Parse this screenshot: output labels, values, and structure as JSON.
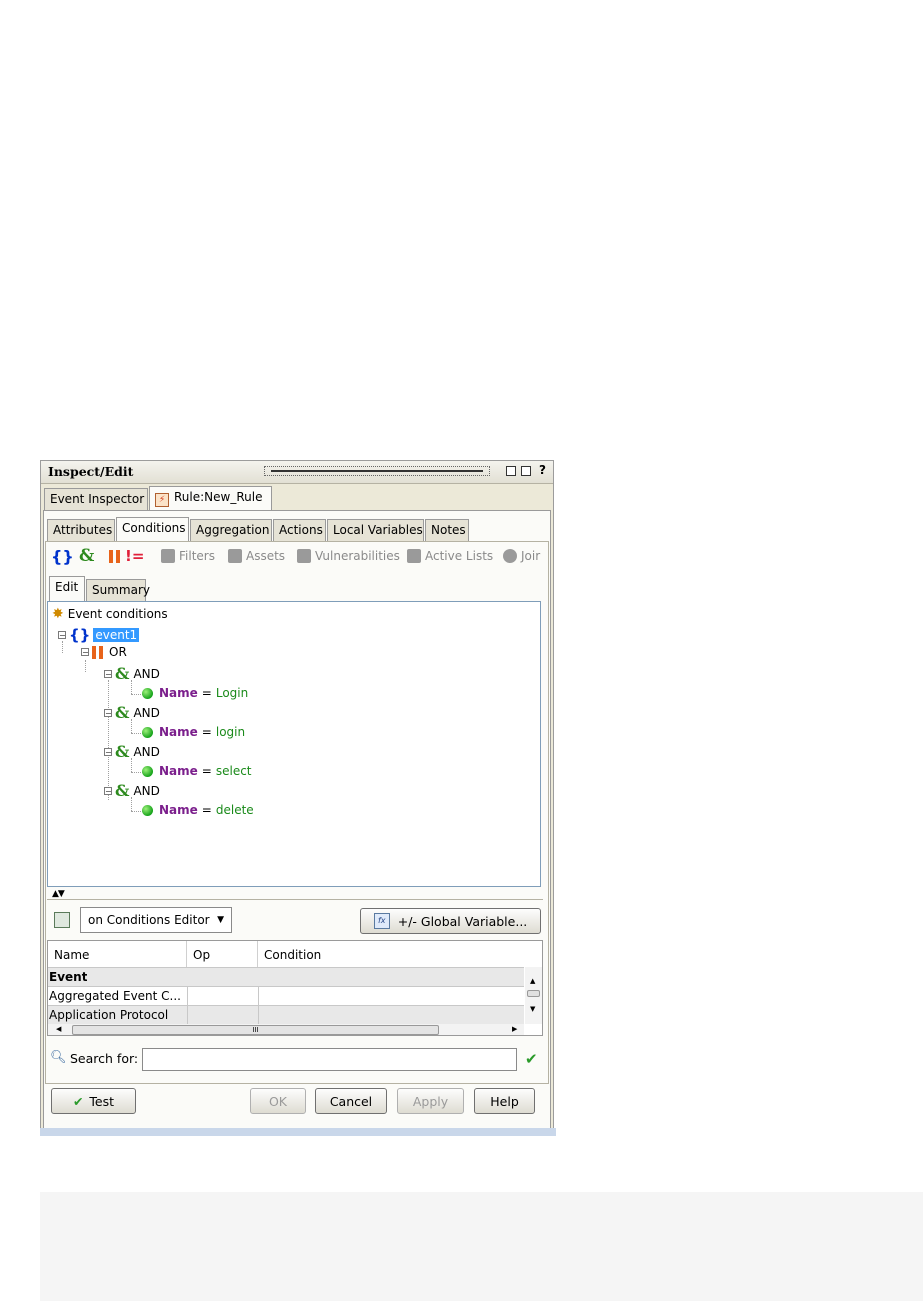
{
  "window": {
    "title": "Inspect/Edit",
    "help_glyph": "?"
  },
  "top_tabs": [
    {
      "label": "Event Inspector"
    },
    {
      "label": "Rule:New_Rule"
    }
  ],
  "sub_tabs": [
    {
      "label": "Attributes"
    },
    {
      "label": "Conditions"
    },
    {
      "label": "Aggregation"
    },
    {
      "label": "Actions"
    },
    {
      "label": "Local Variables"
    },
    {
      "label": "Notes"
    }
  ],
  "toolbar": {
    "brace_glyph": "{}",
    "and_glyph": "&",
    "not_glyph": "!=",
    "filters": "Filters",
    "assets": "Assets",
    "vulnerabilities": "Vulnerabilities",
    "active_lists": "Active Lists",
    "join": "Joir"
  },
  "editor_tabs": [
    {
      "label": "Edit"
    },
    {
      "label": "Summary"
    }
  ],
  "tree": {
    "root": "Event conditions",
    "event": "event1",
    "or_label": "OR",
    "and_label": "AND",
    "brace_glyph": "{}",
    "and_glyph": "&",
    "conditions": [
      {
        "field": "Name",
        "op": "=",
        "value": "Login"
      },
      {
        "field": "Name",
        "op": "=",
        "value": "login"
      },
      {
        "field": "Name",
        "op": "=",
        "value": "select"
      },
      {
        "field": "Name",
        "op": "=",
        "value": "delete"
      }
    ]
  },
  "editor_select": "on Conditions Editor",
  "global_variable_button": "+/- Global Variable...",
  "table": {
    "headers": [
      "Name",
      "Op",
      "Condition"
    ],
    "rows": [
      {
        "name": "Event",
        "op": "",
        "condition": ""
      },
      {
        "name": "Aggregated Event C...",
        "op": "",
        "condition": ""
      },
      {
        "name": "Application Protocol",
        "op": "",
        "condition": ""
      }
    ],
    "scroll_thumb_glyph": "III"
  },
  "search": {
    "label": "Search for:",
    "value": ""
  },
  "buttons": {
    "test": "Test",
    "ok": "OK",
    "cancel": "Cancel",
    "apply": "Apply",
    "help": "Help"
  }
}
